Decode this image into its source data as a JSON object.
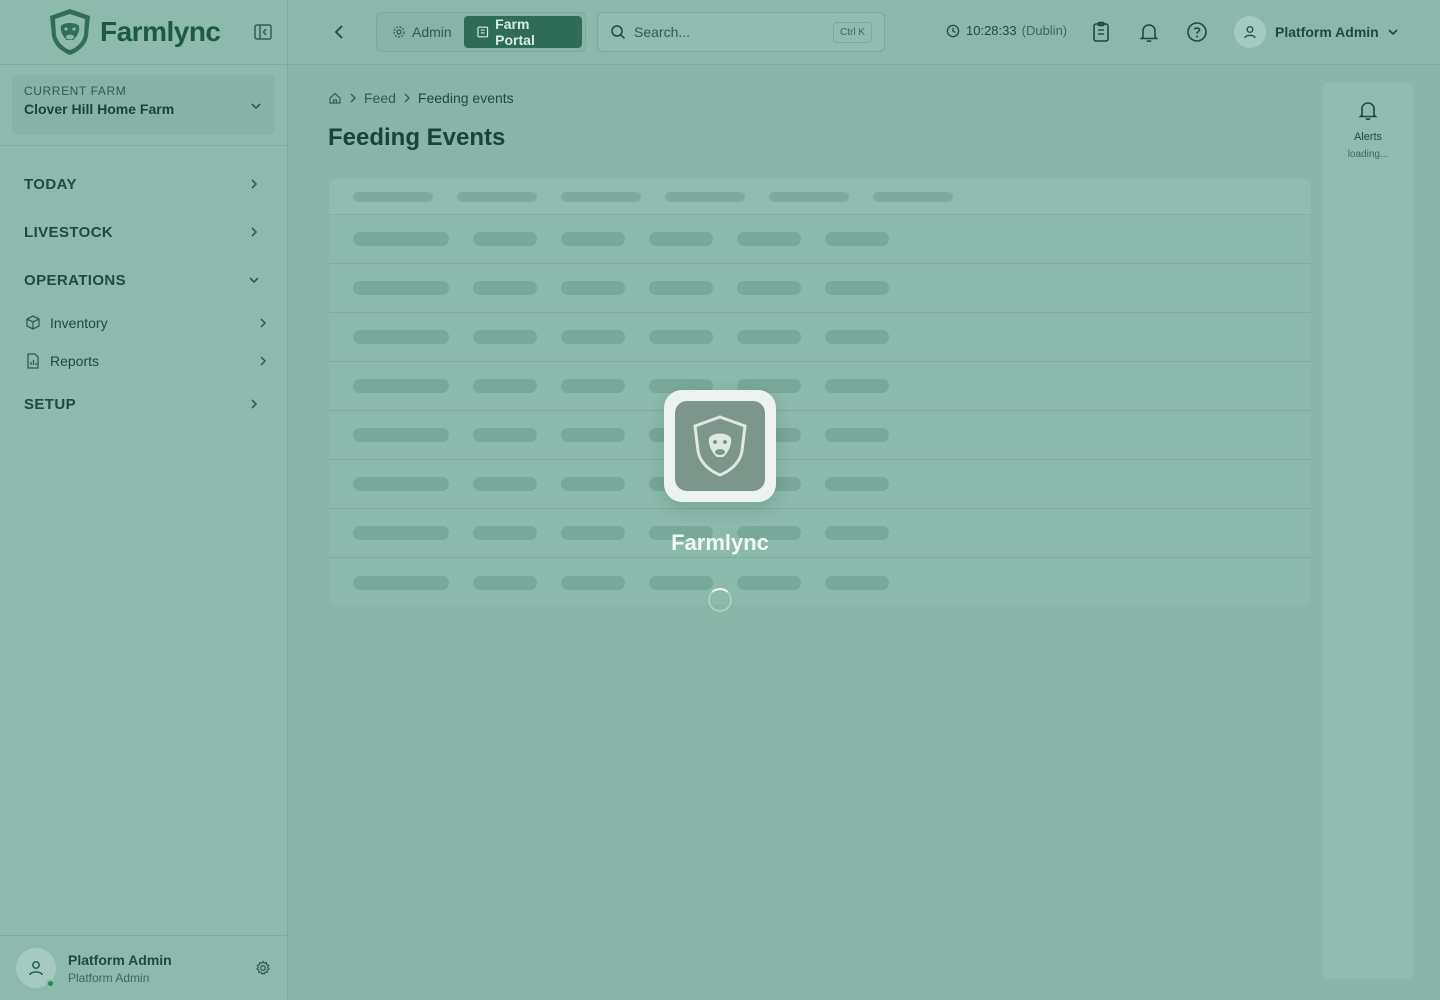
{
  "brand": {
    "name": "Farmlync"
  },
  "farm_selector": {
    "label": "CURRENT FARM",
    "value": "Clover Hill Home Farm"
  },
  "sidebar": {
    "sections": [
      {
        "label": "TODAY",
        "state": "collapsed"
      },
      {
        "label": "LIVESTOCK",
        "state": "collapsed"
      },
      {
        "label": "OPERATIONS",
        "state": "expanded"
      },
      {
        "label": "SETUP",
        "state": "collapsed"
      }
    ],
    "operations_items": [
      {
        "label": "Inventory",
        "icon": "box-icon"
      },
      {
        "label": "Reports",
        "icon": "report-icon"
      }
    ]
  },
  "user_footer": {
    "name": "Platform Admin",
    "role": "Platform Admin",
    "status_color": "#1e9150"
  },
  "topbar": {
    "mode_switch": [
      {
        "label": "Admin",
        "icon": "gear-icon",
        "active": false
      },
      {
        "label": "Farm Portal",
        "icon": "building-icon",
        "active": true
      }
    ],
    "search": {
      "placeholder": "Search...",
      "shortcut": "Ctrl K"
    },
    "clock": {
      "time": "10:28:33",
      "zone": "(Dublin)"
    },
    "account": {
      "name": "Platform Admin"
    }
  },
  "breadcrumb": {
    "level1": "Feed",
    "current": "Feeding events"
  },
  "page": {
    "title": "Feeding Events"
  },
  "alerts_rail": {
    "title": "Alerts",
    "status": "loading..."
  },
  "loading_overlay": {
    "name": "Farmlync"
  },
  "colors": {
    "accent": "#2e6c58",
    "brand": "#1d5a45",
    "overlay_tint": "#87b5a8"
  }
}
